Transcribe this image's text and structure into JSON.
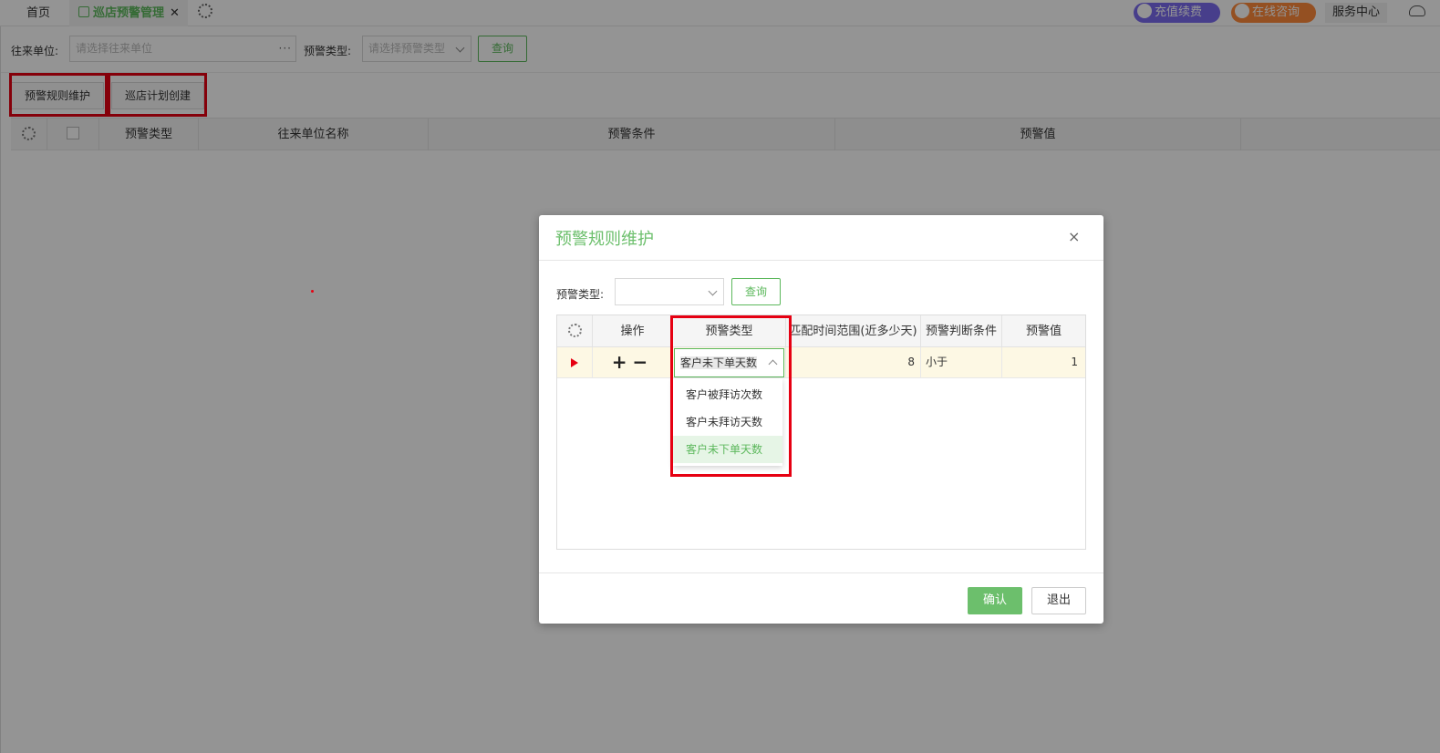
{
  "tabs": {
    "home": "首页",
    "active": "巡店预警管理",
    "close": "✕"
  },
  "header": {
    "recharge": "充值续费",
    "consult": "在线咨询",
    "service": "服务中心"
  },
  "filters": {
    "partner_label": "往来单位:",
    "partner_placeholder": "请选择往来单位",
    "partner_more": "···",
    "type_label": "预警类型:",
    "type_placeholder": "请选择预警类型",
    "query": "查询"
  },
  "toolbar": {
    "rule_btn": "预警规则维护",
    "plan_btn": "巡店计划创建"
  },
  "grid": {
    "columns": [
      "预警类型",
      "往来单位名称",
      "预警条件",
      "预警值"
    ]
  },
  "modal": {
    "title": "预警规则维护",
    "close": "×",
    "type_label": "预警类型:",
    "query": "查询",
    "columns": [
      "操作",
      "预警类型",
      "匹配时间范围(近多少天)",
      "预警判断条件",
      "预警值"
    ],
    "row": {
      "ops": "+−",
      "type": "客户未下单天数",
      "range": "8",
      "condition": "小于",
      "value": "1"
    },
    "options": [
      "客户被拜访次数",
      "客户未拜访天数",
      "客户未下单天数"
    ],
    "selected_option_index": 2,
    "ok": "确认",
    "exit": "退出"
  },
  "colors": {
    "accent": "#5cb85c",
    "highlight": "#e60012"
  }
}
